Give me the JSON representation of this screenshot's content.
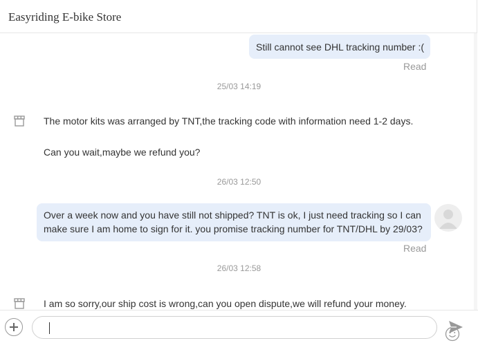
{
  "header": {
    "title": "Easyriding E-bike Store"
  },
  "messages": {
    "out1": {
      "text": "Still cannot see DHL tracking number :(",
      "status": "Read"
    },
    "ts1": "25/03 14:19",
    "in1": {
      "line1": "The motor kits was arranged by TNT,the tracking code with information need 1-2 days.",
      "line2": "Can you wait,maybe we refund you?"
    },
    "ts2": "26/03 12:50",
    "out2": {
      "line1": "Over a week now and you have still not shipped? TNT is ok, I just need tracking so I can",
      "line2": "make sure I am home to sign for it. you promise tracking number for TNT/DHL by 29/03?",
      "status": "Read"
    },
    "ts3": "26/03 12:58",
    "in2": {
      "line1": "I am so sorry,our ship cost is wrong,can you open dispute,we will refund your money."
    }
  },
  "composer": {
    "placeholder": "",
    "value": ""
  },
  "icons": {
    "store": "store-icon",
    "avatar": "user-avatar",
    "add": "plus-circle-icon",
    "emoji": "smiley-icon",
    "send": "send-icon"
  },
  "colors": {
    "outgoing_bubble": "#e6eefa",
    "muted_text": "#999999"
  }
}
